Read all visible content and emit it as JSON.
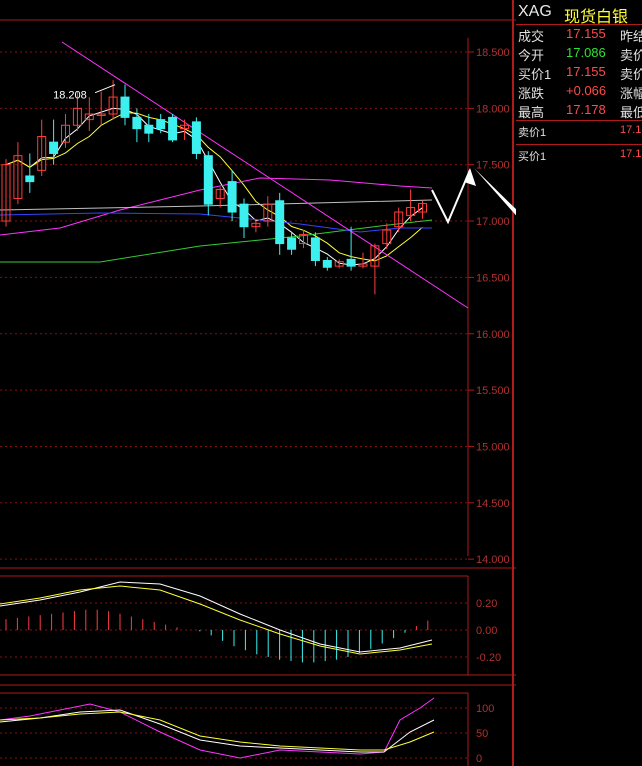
{
  "quote": {
    "symbol": "XAG",
    "name": "现货白银",
    "last_label": "成交",
    "last": "17.155",
    "prev_label": "昨结",
    "open_label": "今开",
    "open": "17.086",
    "ask_label": "卖价",
    "bid_label": "买价1",
    "bid": "17.155",
    "sell_label": "卖价",
    "change_label": "涨跌",
    "change": "+0.066",
    "amp_label": "涨幅",
    "high_label": "最高",
    "high": "17.178",
    "low_label": "最低",
    "ask1_label": "卖价1",
    "ask1": "17.1",
    "bid1_label": "买价1",
    "bid1": "17.1"
  },
  "colors": {
    "up": "#ff3c3c",
    "down": "#3cf0f0",
    "grid": "#8a0e0e",
    "axis": "#b01a1a",
    "ma1": "#ffffff",
    "ma2": "#ffff33",
    "ma3": "#ff33ff",
    "ma4": "#33cc33",
    "ma5": "#3344ff",
    "arrow": "#ffffff"
  },
  "chart_data": [
    {
      "type": "candlestick",
      "panel": "main",
      "yticks": [
        "18.500",
        "18.000",
        "17.500",
        "17.000",
        "16.500",
        "16.000",
        "15.500",
        "15.000",
        "14.500",
        "14.000"
      ],
      "ylim": [
        14.0,
        18.6
      ],
      "peak_label": "18.208",
      "candles": [
        {
          "o": 17.0,
          "h": 17.55,
          "l": 16.95,
          "c": 17.5
        },
        {
          "o": 17.2,
          "h": 17.7,
          "l": 17.15,
          "c": 17.58
        },
        {
          "o": 17.4,
          "h": 17.6,
          "l": 17.25,
          "c": 17.35
        },
        {
          "o": 17.45,
          "h": 17.9,
          "l": 17.4,
          "c": 17.75
        },
        {
          "o": 17.7,
          "h": 17.9,
          "l": 17.5,
          "c": 17.6
        },
        {
          "o": 17.7,
          "h": 17.95,
          "l": 17.65,
          "c": 17.85
        },
        {
          "o": 17.85,
          "h": 18.15,
          "l": 17.8,
          "c": 18.0
        },
        {
          "o": 17.9,
          "h": 18.1,
          "l": 17.8,
          "c": 17.95
        },
        {
          "o": 17.95,
          "h": 18.15,
          "l": 17.85,
          "c": 17.95
        },
        {
          "o": 17.95,
          "h": 18.25,
          "l": 17.9,
          "c": 18.1
        },
        {
          "o": 18.1,
          "h": 18.21,
          "l": 17.85,
          "c": 17.92
        },
        {
          "o": 17.92,
          "h": 18.0,
          "l": 17.7,
          "c": 17.82
        },
        {
          "o": 17.85,
          "h": 17.95,
          "l": 17.7,
          "c": 17.78
        },
        {
          "o": 17.9,
          "h": 17.95,
          "l": 17.78,
          "c": 17.82
        },
        {
          "o": 17.92,
          "h": 17.95,
          "l": 17.7,
          "c": 17.72
        },
        {
          "o": 17.82,
          "h": 17.9,
          "l": 17.72,
          "c": 17.85
        },
        {
          "o": 17.88,
          "h": 17.92,
          "l": 17.55,
          "c": 17.6
        },
        {
          "o": 17.58,
          "h": 17.62,
          "l": 17.05,
          "c": 17.15
        },
        {
          "o": 17.2,
          "h": 17.3,
          "l": 17.12,
          "c": 17.28
        },
        {
          "o": 17.35,
          "h": 17.45,
          "l": 17.0,
          "c": 17.08
        },
        {
          "o": 17.15,
          "h": 17.2,
          "l": 16.85,
          "c": 16.95
        },
        {
          "o": 16.95,
          "h": 17.02,
          "l": 16.9,
          "c": 16.98
        },
        {
          "o": 17.0,
          "h": 17.22,
          "l": 16.95,
          "c": 17.15
        },
        {
          "o": 17.18,
          "h": 17.25,
          "l": 16.7,
          "c": 16.8
        },
        {
          "o": 16.85,
          "h": 16.9,
          "l": 16.7,
          "c": 16.75
        },
        {
          "o": 16.8,
          "h": 16.92,
          "l": 16.76,
          "c": 16.88
        },
        {
          "o": 16.85,
          "h": 16.9,
          "l": 16.6,
          "c": 16.65
        },
        {
          "o": 16.65,
          "h": 16.68,
          "l": 16.56,
          "c": 16.59
        },
        {
          "o": 16.6,
          "h": 16.66,
          "l": 16.58,
          "c": 16.64
        },
        {
          "o": 16.66,
          "h": 16.95,
          "l": 16.56,
          "c": 16.6
        },
        {
          "o": 16.6,
          "h": 16.72,
          "l": 16.58,
          "c": 16.62
        },
        {
          "o": 16.6,
          "h": 16.8,
          "l": 16.35,
          "c": 16.78
        },
        {
          "o": 16.8,
          "h": 16.98,
          "l": 16.75,
          "c": 16.92
        },
        {
          "o": 16.95,
          "h": 17.12,
          "l": 16.9,
          "c": 17.08
        },
        {
          "o": 17.05,
          "h": 17.28,
          "l": 17.0,
          "c": 17.12
        },
        {
          "o": 17.08,
          "h": 17.18,
          "l": 17.02,
          "c": 17.155
        }
      ]
    },
    {
      "type": "bar",
      "panel": "macd",
      "yticks": [
        "0.20",
        "0.00",
        "-0.20"
      ],
      "ylim": [
        -0.3,
        0.3
      ],
      "values": [
        0.08,
        0.09,
        0.1,
        0.11,
        0.12,
        0.13,
        0.14,
        0.15,
        0.15,
        0.14,
        0.12,
        0.1,
        0.08,
        0.06,
        0.04,
        0.02,
        0.0,
        -0.01,
        -0.04,
        -0.08,
        -0.12,
        -0.15,
        -0.18,
        -0.2,
        -0.22,
        -0.23,
        -0.24,
        -0.24,
        -0.23,
        -0.22,
        -0.2,
        -0.17,
        -0.14,
        -0.1,
        -0.06,
        -0.02,
        0.03,
        0.07
      ]
    },
    {
      "type": "line",
      "panel": "kdj",
      "yticks": [
        "100",
        "50",
        "0"
      ],
      "ylim": [
        0,
        120
      ]
    }
  ]
}
